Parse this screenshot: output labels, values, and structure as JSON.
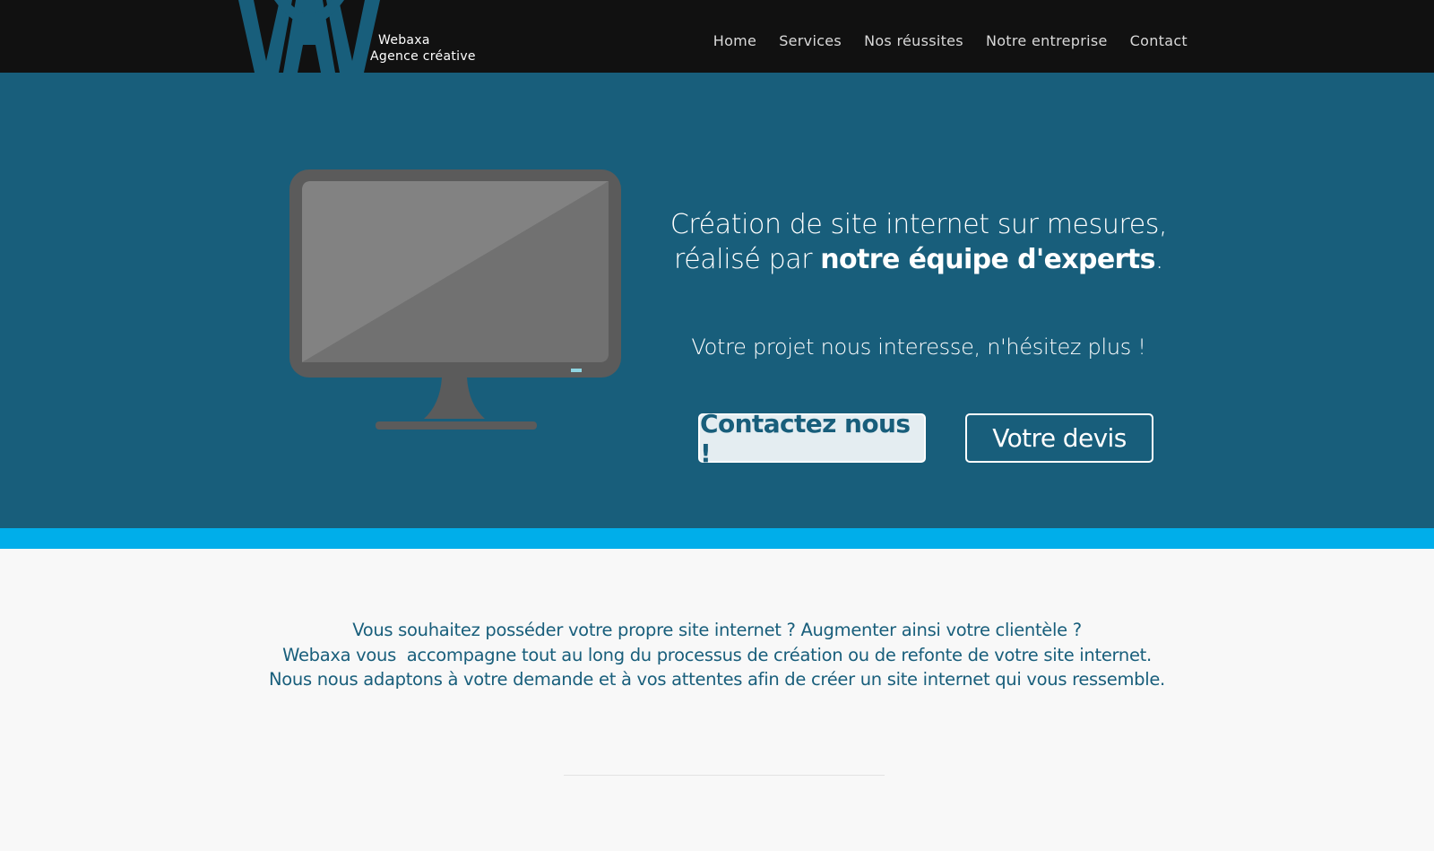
{
  "header": {
    "brand_name": "Webaxa",
    "brand_tagline": "Agence créative",
    "logo_icon": "webaxa-logo",
    "nav": [
      {
        "label": "Home"
      },
      {
        "label": "Services"
      },
      {
        "label": "Nos réussites"
      },
      {
        "label": "Notre entreprise"
      },
      {
        "label": "Contact"
      }
    ]
  },
  "hero": {
    "illustration": "monitor-icon",
    "headline_line1": "Création de site internet sur mesures,",
    "headline_line2_prefix": "réalisé par ",
    "headline_line2_bold": "notre équipe d'experts",
    "headline_line2_suffix": ".",
    "subheadline": "Votre projet nous interesse, n'hésitez plus !",
    "button_contact": "Contactez nous !",
    "button_quote": "Votre devis"
  },
  "intro": {
    "line1": "Vous souhaitez posséder votre propre site internet ? Augmenter ainsi votre clientèle ?",
    "line2": "Webaxa vous  accompagne tout au long du processus de création ou de refonte de votre site internet.",
    "line3": "Nous nous adaptons à votre demande et à vos attentes afin de créer un site internet qui vous ressemble."
  },
  "colors": {
    "header_bg": "#111111",
    "brand_blue": "#185e7b",
    "accent_cyan": "#00aeea",
    "page_bg": "#f8f8f8"
  }
}
